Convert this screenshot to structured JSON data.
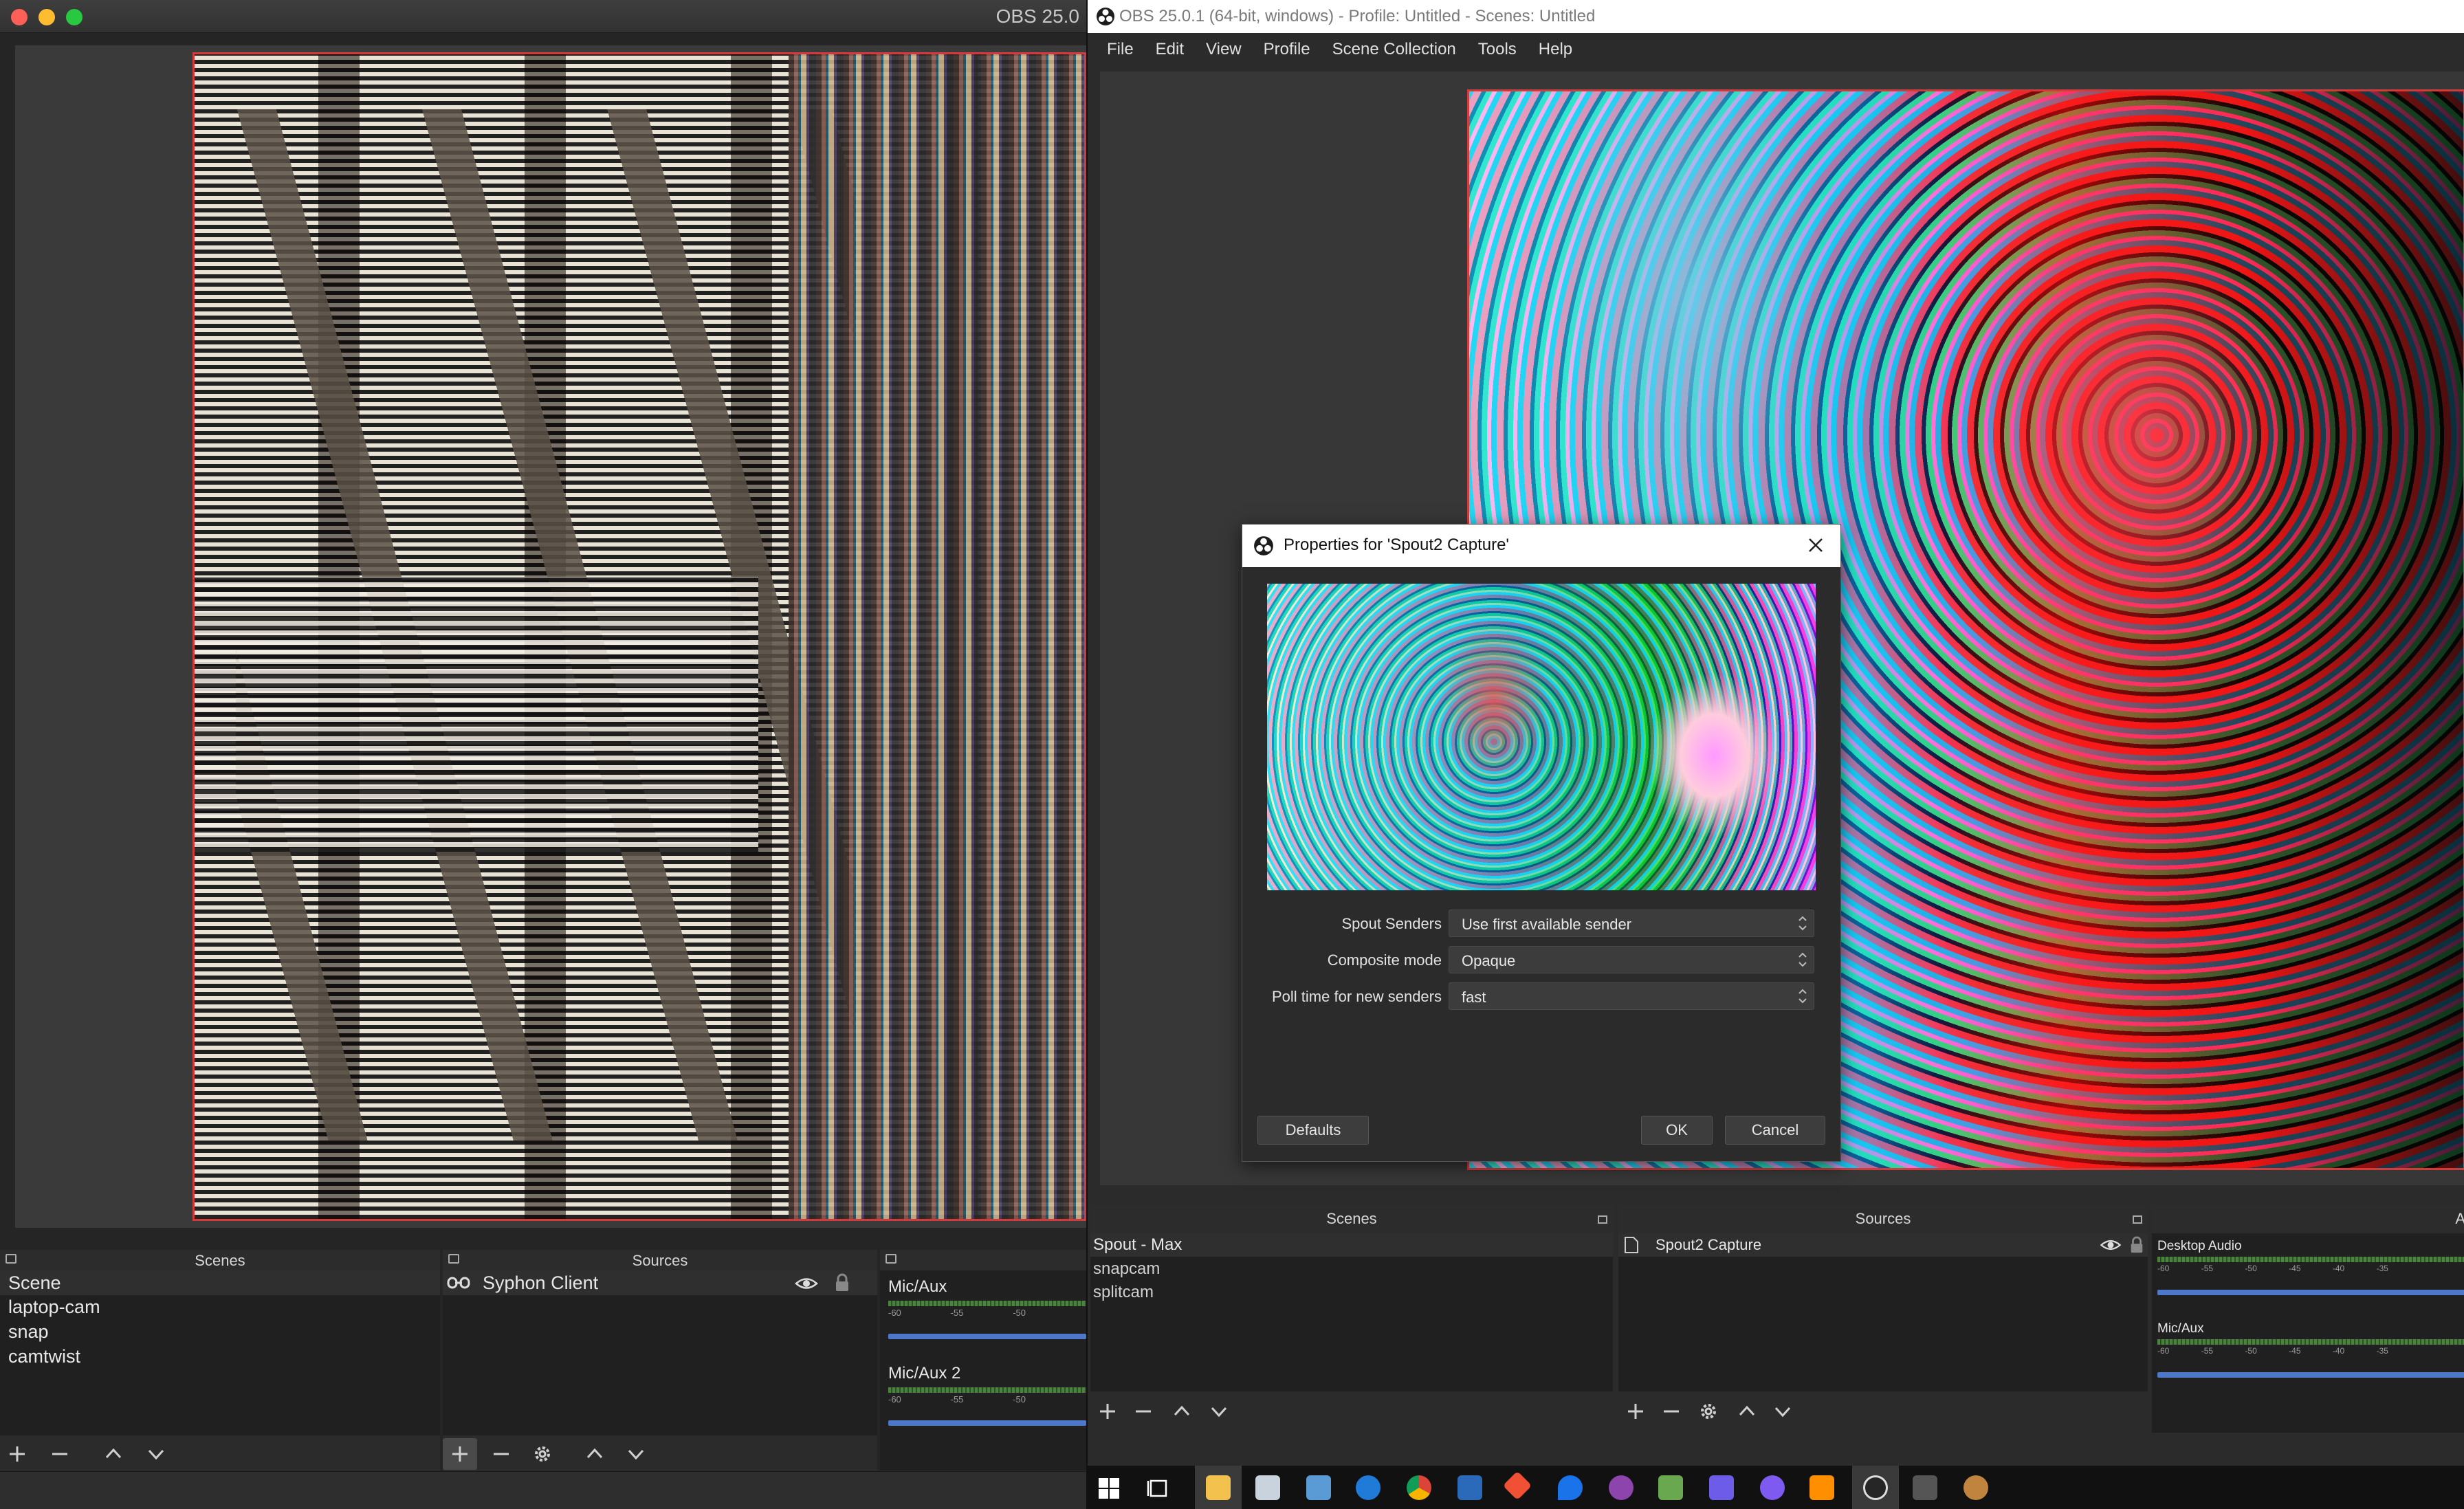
{
  "mac": {
    "title": "OBS 25.0",
    "scenes_title": "Scenes",
    "sources_title": "Sources",
    "scenes": [
      "Scene",
      "laptop-cam",
      "snap",
      "camtwist"
    ],
    "sources": [
      {
        "name": "Syphon Client"
      }
    ],
    "mixer": [
      {
        "name": "Mic/Aux",
        "ticks": [
          "-60",
          "-55",
          "-50"
        ]
      },
      {
        "name": "Mic/Aux 2",
        "ticks": [
          "-60",
          "-55",
          "-50"
        ]
      }
    ]
  },
  "win": {
    "title": "OBS 25.0.1 (64-bit, windows) - Profile: Untitled - Scenes: Untitled",
    "menu": [
      "File",
      "Edit",
      "View",
      "Profile",
      "Scene Collection",
      "Tools",
      "Help"
    ],
    "scenes_title": "Scenes",
    "sources_title": "Sources",
    "mixer_title_partial": "A",
    "scenes": [
      "Spout - Max",
      "snapcam",
      "splitcam"
    ],
    "sources": [
      {
        "name": "Spout2 Capture"
      }
    ],
    "mixer": [
      {
        "name": "Desktop Audio",
        "ticks": [
          "-60",
          "-55",
          "-50",
          "-45",
          "-40",
          "-35"
        ]
      },
      {
        "name": "Mic/Aux",
        "ticks": [
          "-60",
          "-55",
          "-50",
          "-45",
          "-40",
          "-35"
        ]
      }
    ]
  },
  "dialog": {
    "title": "Properties for 'Spout2 Capture'",
    "fields": [
      {
        "label": "Spout Senders",
        "value": "Use first available sender"
      },
      {
        "label": "Composite mode",
        "value": "Opaque"
      },
      {
        "label": "Poll time for new senders",
        "value": "fast"
      }
    ],
    "defaults_label": "Defaults",
    "ok_label": "OK",
    "cancel_label": "Cancel"
  },
  "taskbar": {
    "icons": [
      "windows-start",
      "task-view",
      "file-explorer",
      "monitor-app",
      "app-window",
      "edge",
      "chrome",
      "powershell",
      "git",
      "maps",
      "app-purple",
      "app-green",
      "app-m",
      "obs-circle",
      "sublime",
      "obs",
      "app-gray",
      "app-character"
    ]
  },
  "colors": {
    "selection_red": "#d43a3a",
    "meter_green": "#4c8a3c",
    "volume_blue": "#4d78c9",
    "panel_bg": "#202020"
  }
}
